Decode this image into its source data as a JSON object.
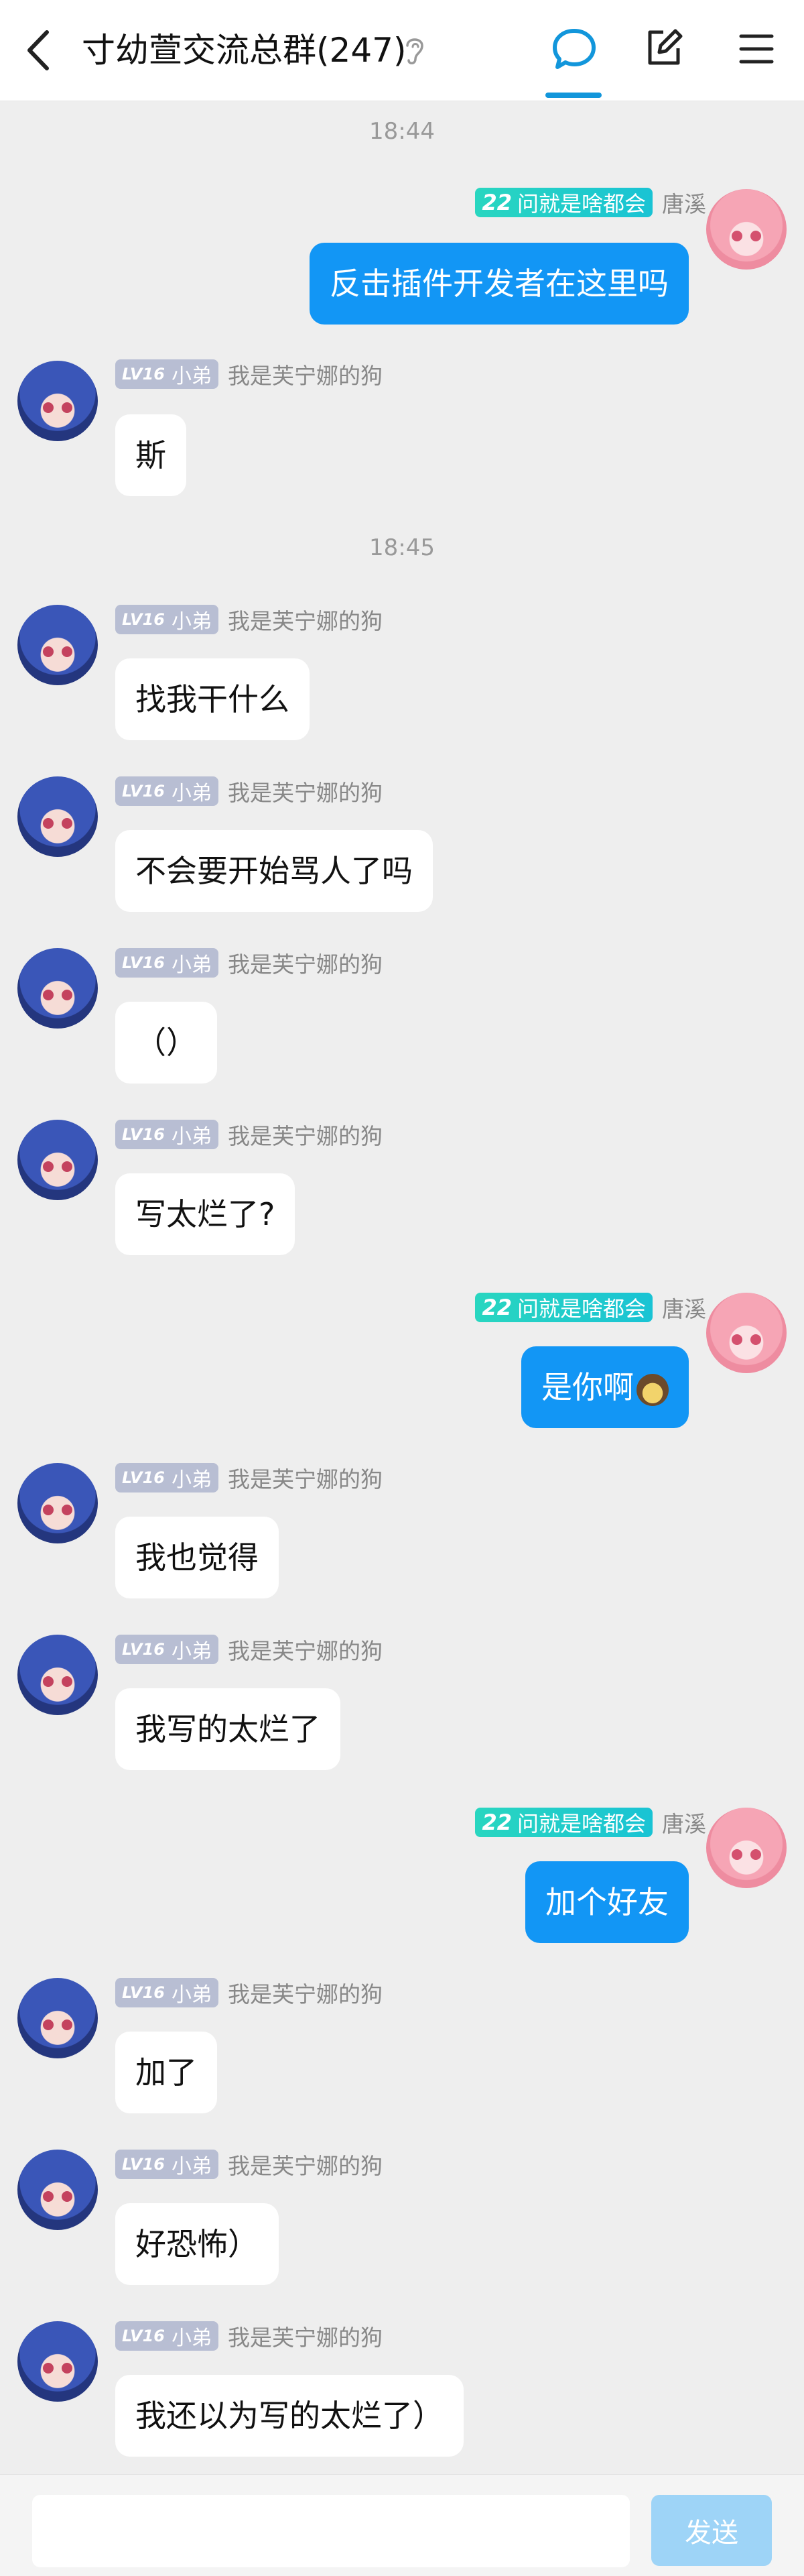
{
  "header": {
    "title": "寸幼萱交流总群(247)"
  },
  "times": [
    "18:44",
    "18:45"
  ],
  "users": {
    "left": {
      "level": "LV16",
      "rank": "小弟",
      "nick": "我是芙宁娜的狗"
    },
    "right": {
      "level": "22",
      "rank": "问就是啥都会",
      "nick": "唐溪"
    }
  },
  "messages": [
    {
      "text": "反击插件开发者在这里吗"
    },
    {
      "text": "斯"
    },
    {
      "text": "找我干什么"
    },
    {
      "text": "不会要开始骂人了吗"
    },
    {
      "text": "（）"
    },
    {
      "text": "写太烂了?"
    },
    {
      "text": "是你啊"
    },
    {
      "text": "我也觉得"
    },
    {
      "text": "我写的太烂了"
    },
    {
      "text": "加个好友"
    },
    {
      "text": "加了"
    },
    {
      "text": "好恐怖）"
    },
    {
      "text": "我还以为写的太烂了）"
    }
  ],
  "footer": {
    "input_value": "",
    "send_label": "发送"
  },
  "colors": {
    "accent": "#1296db",
    "bubble_self": "#1296f5",
    "bubble_other": "#ffffff",
    "background": "#eeeeee"
  }
}
